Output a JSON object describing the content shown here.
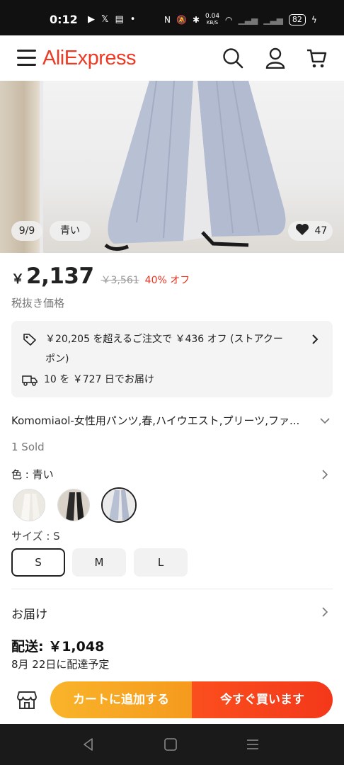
{
  "status_bar": {
    "time": "0:12",
    "speed_value": "0.04",
    "speed_unit": "KB/S",
    "battery": "82"
  },
  "header": {
    "logo": "AliExpress"
  },
  "gallery": {
    "counter": "9/9",
    "color_tag": "青い",
    "likes": "47"
  },
  "price": {
    "currency": "￥",
    "current": "2,137",
    "original": "￥3,561",
    "discount": "40% オフ",
    "tax_note": "税抜き価格"
  },
  "promo": {
    "coupon_line1": "￥20,205 を超えるご注文で ￥436 オフ (ストアクー",
    "coupon_line2": "ポン)",
    "delivery_offer": "10 を ￥727 日でお届け"
  },
  "product": {
    "title": "Komomiaol-女性用パンツ,春,ハイウエスト,プリーツ,ファ...",
    "sold": "1 Sold",
    "color_label": "色 : 青い",
    "size_label": "サイズ : S",
    "sizes": [
      "S",
      "M",
      "L"
    ],
    "selected_size": "S"
  },
  "delivery": {
    "section_label": "お届け",
    "shipping": "配送: ￥1,048",
    "eta": "8月 22日に配達予定"
  },
  "actions": {
    "add_to_cart": "カートに追加する",
    "buy_now": "今すぐ買います"
  },
  "colors": {
    "brand": "#ee3a24",
    "discount": "#e8321e",
    "cart_button": "#f9b42a",
    "buy_button": "#f3381a"
  }
}
